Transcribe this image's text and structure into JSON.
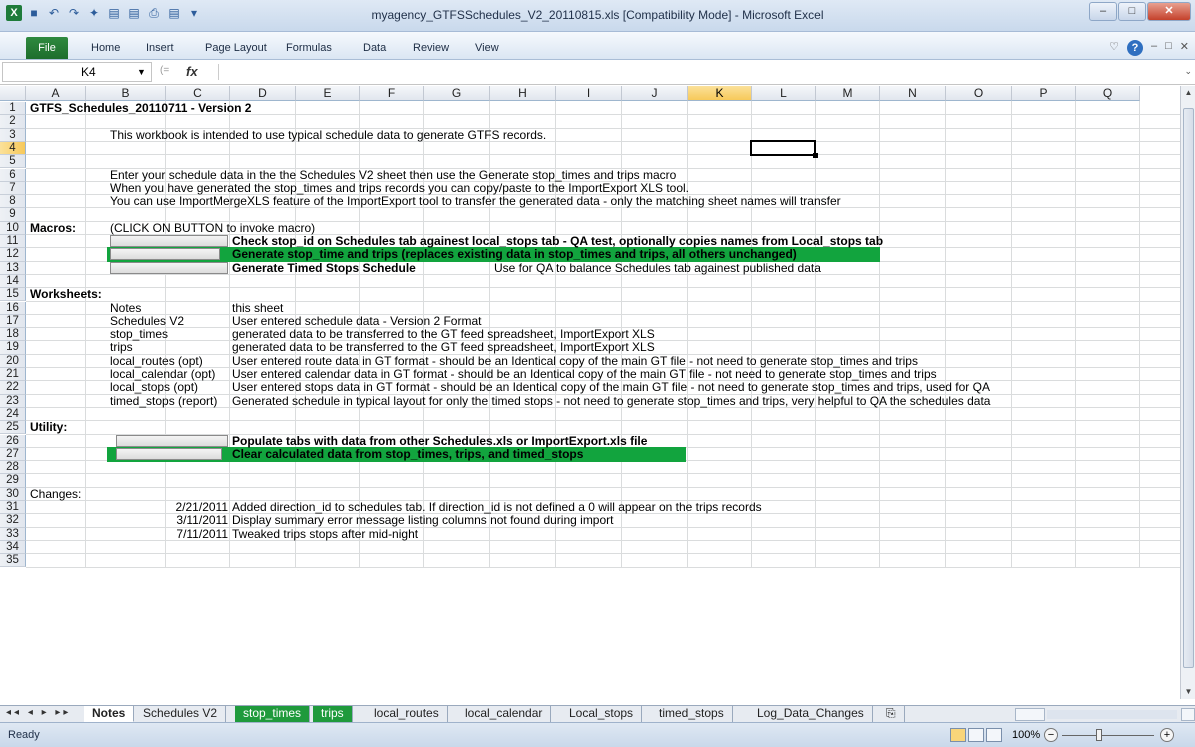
{
  "window": {
    "title": "myagency_GTFSSchedules_V2_20110815.xls [Compatibility Mode] - Microsoft Excel",
    "min": "–",
    "max": "□",
    "close": "✕"
  },
  "qat": [
    "X",
    "■",
    "↶",
    "↷",
    "✦",
    "▤",
    "▤",
    "⎙",
    "▤",
    "▾"
  ],
  "ribbon": {
    "file": "File",
    "tabs": [
      "Home",
      "Insert",
      "Page Layout",
      "Formulas",
      "Data",
      "Review",
      "View"
    ],
    "right_icons": [
      "♡",
      "?",
      "–",
      "□",
      "✕"
    ]
  },
  "formula_bar": {
    "name_box": "K4",
    "fx": "fx",
    "value": ""
  },
  "columns": [
    "A",
    "B",
    "C",
    "D",
    "E",
    "F",
    "G",
    "H",
    "I",
    "J",
    "K",
    "L",
    "M",
    "N",
    "O",
    "P",
    "Q"
  ],
  "selected_col": "K",
  "rows": [
    "1",
    "2",
    "3",
    "4",
    "5",
    "6",
    "7",
    "8",
    "9",
    "10",
    "11",
    "12",
    "13",
    "14",
    "15",
    "16",
    "17",
    "18",
    "19",
    "20",
    "21",
    "22",
    "23",
    "24",
    "25",
    "26",
    "27",
    "28",
    "29",
    "30",
    "31",
    "32",
    "33",
    "34",
    "35"
  ],
  "selected_row": "4",
  "cells": {
    "a1": "GTFS_Schedules_20110711 - Version 2",
    "b3": "This workbook is intended to use typical schedule data to generate GTFS records.",
    "b6": "Enter your schedule data in the the Schedules V2 sheet then use the Generate stop_times and trips macro",
    "b7": "When you have generated the stop_times and trips records you can copy/paste to the ImportExport XLS tool.",
    "b8": "You can use ImportMergeXLS feature of the ImportExport tool to transfer the generated data - only the matching sheet names will transfer",
    "a10": "Macros:",
    "b10": "(CLICK ON BUTTON to invoke macro)",
    "c11": "Check stop_id on Schedules tab againest local_stops tab - QA test, optionally copies names from Local_stops tab",
    "c12": "Generate stop_time and trips (replaces existing data in stop_times and trips, all others unchanged)",
    "c13": "Generate Timed Stops Schedule",
    "f13": "Use for QA to balance Schedules tab againest published data",
    "a15": "Worksheets:",
    "b16": "Notes",
    "c16": "this sheet",
    "b17": "Schedules V2",
    "c17": "User entered schedule data - Version 2 Format",
    "b18": "stop_times",
    "c18": "generated data to be transferred to the GT feed spreadsheet, ImportExport XLS",
    "b19": "trips",
    "c19": "generated data to be transferred to the GT feed spreadsheet, ImportExport XLS",
    "b20": "local_routes (opt)",
    "c20": "User entered route data in GT format - should be an Identical copy of the main GT file  - not need to generate stop_times and trips",
    "b21": "local_calendar (opt)",
    "c21": "User entered calendar data in GT format - should be an Identical copy of the main GT file  - not need to generate stop_times and trips",
    "b22": "local_stops (opt)",
    "c22": "User entered stops data in GT format - should be an Identical copy of the main GT file - not need to generate stop_times and trips, used for QA",
    "b23": "timed_stops (report)",
    "c23": "Generated schedule in typical layout for only the timed stops - not need to generate stop_times and trips, very helpful to QA the schedules data",
    "a25": "Utility:",
    "c26": "Populate tabs with data from other Schedules.xls or ImportExport.xls file",
    "c27": "Clear calculated data from stop_times, trips, and timed_stops",
    "a30": "Changes:",
    "b31": "2/21/2011",
    "c31": "Added direction_id to schedules tab. If direction_id is not defined a 0 will appear on the trips records",
    "b32": "3/11/2011",
    "c32": "Display summary error message listing columns not found during import",
    "b33": "7/11/2011",
    "c33": "Tweaked trips stops after mid-night"
  },
  "sheet_tabs": [
    "Notes",
    "Schedules V2",
    "stop_times",
    "trips",
    "local_routes",
    "local_calendar",
    "Local_stops",
    "timed_stops",
    "Log_Data_Changes",
    "⎘"
  ],
  "tab_nav": "◂◂ ◂ ▸ ▸▸",
  "status": {
    "ready": "Ready",
    "zoom": "100%",
    "zoom_out": "−",
    "zoom_in": "+"
  },
  "colors": {
    "green": "#12a43e",
    "select": "#f7c95a"
  }
}
